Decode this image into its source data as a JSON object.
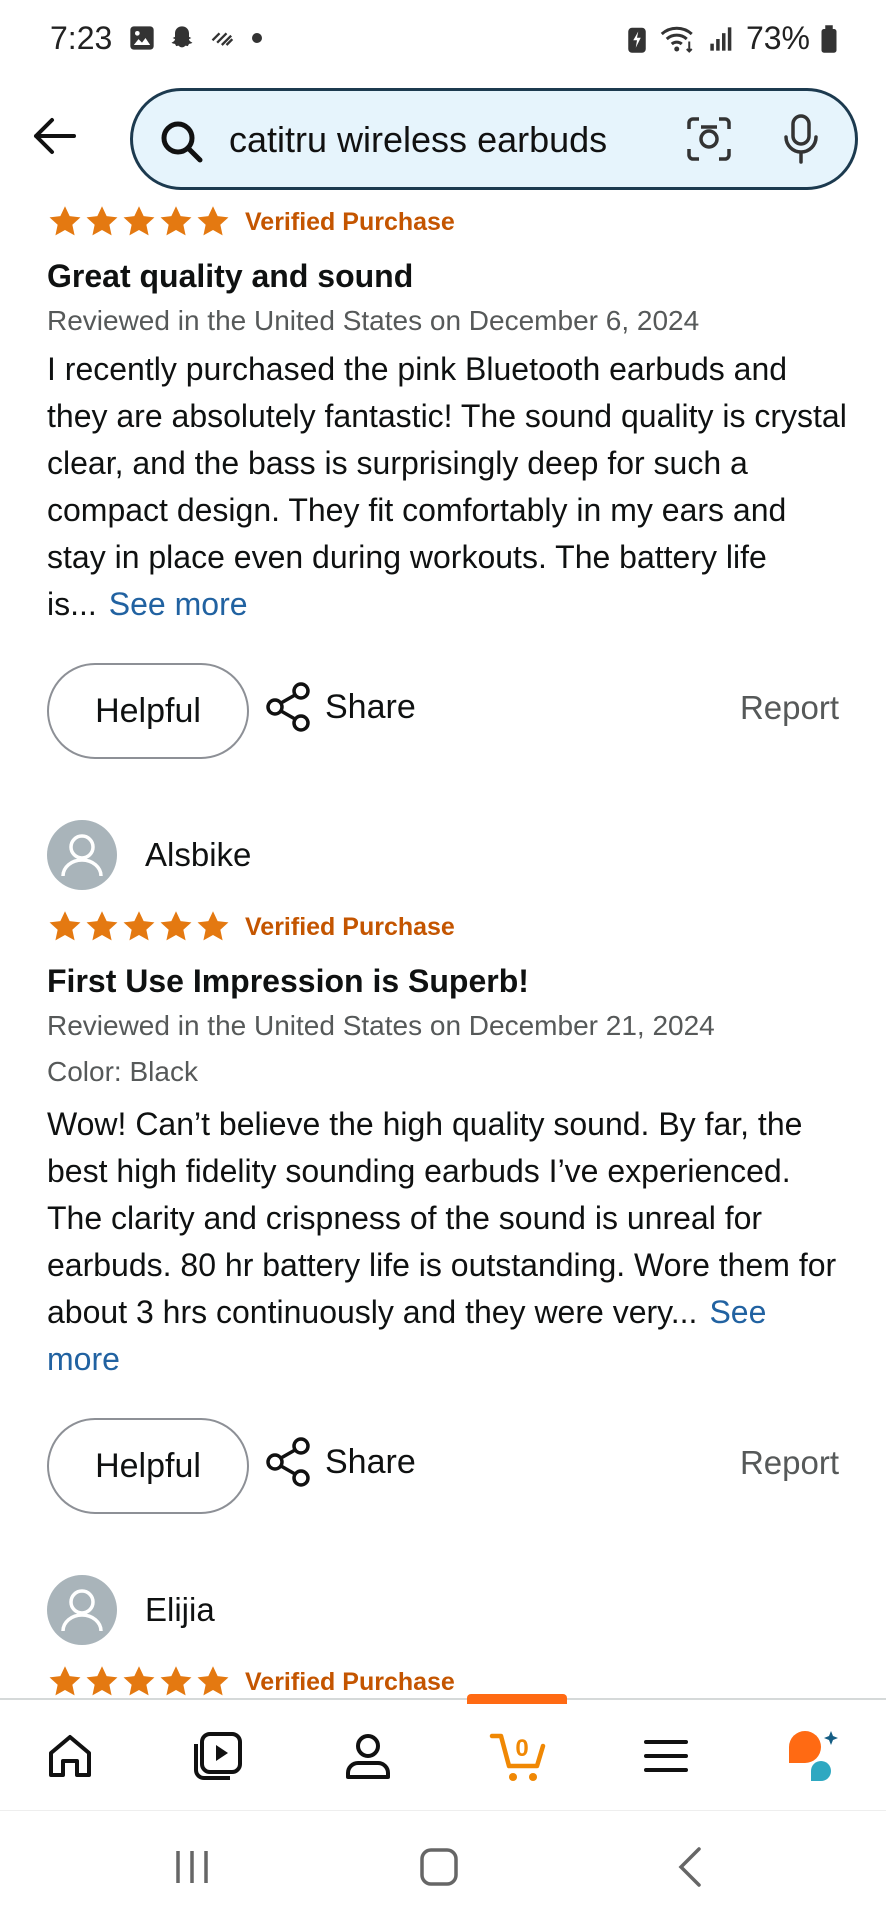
{
  "status_bar": {
    "time": "7:23",
    "battery": "73%",
    "left_icons": [
      "gallery-icon",
      "snapchat-icon",
      "missed-call-icon",
      "dot-icon"
    ],
    "right_icons": [
      "battery-saver-icon",
      "wifi-icon",
      "signal-icon",
      "battery-icon"
    ]
  },
  "search": {
    "query": "catitru wireless earbuds"
  },
  "reviews": [
    {
      "rating": 5,
      "verified_label": "Verified Purchase",
      "title": "Great quality and sound",
      "meta": "Reviewed in the United States on December 6, 2024",
      "body": "I recently purchased the pink Bluetooth earbuds and they are absolutely fantastic! The sound quality is crystal clear, and the bass is surprisingly deep for such a compact design. They fit comfortably in my ears and stay in place even during workouts. The battery life is...",
      "see_more": "See more",
      "helpful_label": "Helpful",
      "share_label": "Share",
      "report_label": "Report"
    },
    {
      "reviewer": "Alsbike",
      "rating": 5,
      "verified_label": "Verified Purchase",
      "title": "First Use Impression is Superb!",
      "meta": "Reviewed in the United States on December 21, 2024",
      "color": "Color: Black",
      "body": "Wow! Can’t believe the high quality sound. By far, the best high fidelity sounding earbuds I’ve experienced. The clarity and crispness of the sound is unreal for earbuds. 80 hr battery life is outstanding. Wore them for about 3 hrs continuously and they were very...",
      "see_more": "See more",
      "helpful_label": "Helpful",
      "share_label": "Share",
      "report_label": "Report"
    },
    {
      "reviewer": "Elijia",
      "rating": 5,
      "verified_label": "Verified Purchase"
    }
  ],
  "bottom_nav": {
    "items": [
      "home-icon",
      "video-icon",
      "account-icon",
      "cart-icon",
      "menu-icon",
      "rufus-icon"
    ],
    "cart_count": "0",
    "active": "cart-icon"
  },
  "colors": {
    "star": "#e47911",
    "verified": "#c45500",
    "link": "#2162a1",
    "accent": "#ff6a13",
    "search_bg": "#e6f4fc"
  }
}
